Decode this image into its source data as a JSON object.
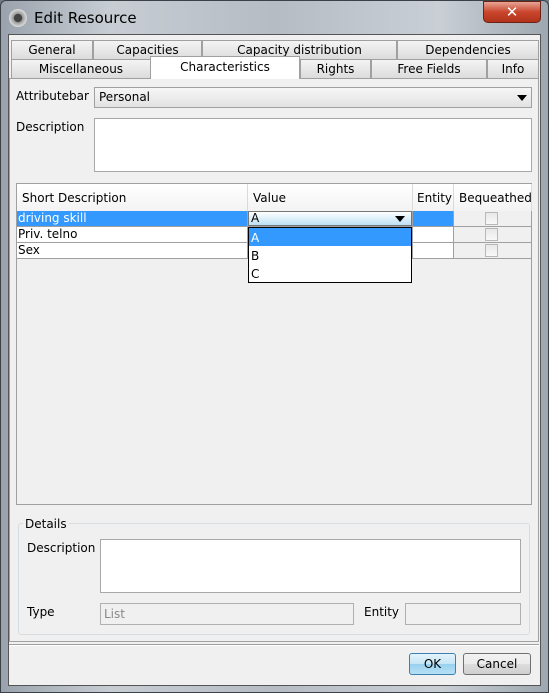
{
  "window": {
    "title": "Edit Resource",
    "close_glyph": "✕"
  },
  "tabs_row1": [
    {
      "label": "General"
    },
    {
      "label": "Capacities"
    },
    {
      "label": "Capacity distribution"
    },
    {
      "label": "Dependencies"
    }
  ],
  "tabs_row2": [
    {
      "label": "Miscellaneous"
    },
    {
      "label": "Characteristics",
      "selected": true
    },
    {
      "label": "Rights"
    },
    {
      "label": "Free Fields"
    },
    {
      "label": "Info"
    }
  ],
  "form": {
    "attributebar_label": "Attributebar",
    "attributebar_value": "Personal",
    "description_label": "Description",
    "description_value": ""
  },
  "table": {
    "columns": [
      "Short Description",
      "Value",
      "Entity",
      "Bequeathed"
    ],
    "rows": [
      {
        "short": "driving skill",
        "value": "A",
        "entity": "",
        "bequeathed": false,
        "selected": true
      },
      {
        "short": "Priv. telno",
        "value": "",
        "entity": "",
        "bequeathed": false
      },
      {
        "short": "Sex",
        "value": "",
        "entity": "",
        "bequeathed": false
      }
    ],
    "dropdown_options": [
      "A",
      "B",
      "C"
    ],
    "dropdown_selected": "A"
  },
  "details": {
    "title": "Details",
    "description_label": "Description",
    "description_value": "",
    "type_label": "Type",
    "type_value": "List",
    "entity_label": "Entity",
    "entity_value": ""
  },
  "buttons": {
    "ok": "OK",
    "cancel": "Cancel"
  },
  "colors": {
    "selection": "#3399ff",
    "close_button": "#c9462c"
  }
}
